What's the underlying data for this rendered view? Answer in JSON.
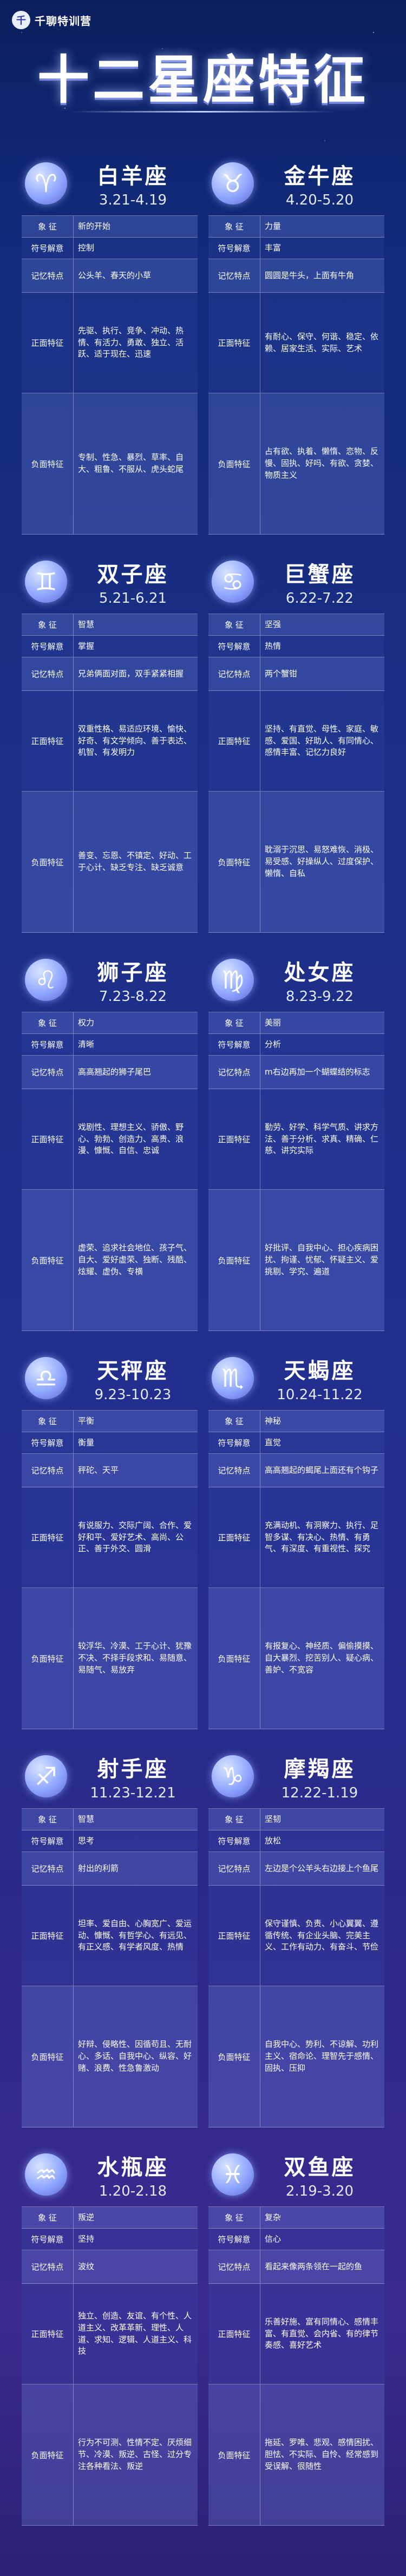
{
  "brand": {
    "name": "千聊特训营",
    "logo_glyph": "千"
  },
  "title": "十二星座特征",
  "row_labels": {
    "symbol": "象    征",
    "symbol_id": "符号解意",
    "mnemonic": "记忆特点",
    "positive": "正面特征",
    "negative": "负面特征"
  },
  "signs": [
    {
      "name": "白羊座",
      "dates": "3.21-4.19",
      "icon": "aries-icon",
      "glyph": "♈",
      "symbol": "新的开始",
      "symbol_id": "控制",
      "mnemonic": "公头羊、春天的小草",
      "positive": "先驱、执行、竞争、冲动、热情、有活力、勇敢、独立、活跃、适于现在、迅速",
      "negative": "专制、性急、暴烈、草率、自大、粗鲁、不服从、虎头蛇尾"
    },
    {
      "name": "金牛座",
      "dates": "4.20-5.20",
      "icon": "taurus-icon",
      "glyph": "♉",
      "symbol": "力量",
      "symbol_id": "丰富",
      "mnemonic": "圆圆是牛头，上面有牛角",
      "positive": "有耐心、保守、何谐、稳定、依赖、居家生活、实际、艺术",
      "negative": "占有欲、执着、懒惰、恋物、反慢、固执、好吗、有欲、贪婪、物质主义"
    },
    {
      "name": "双子座",
      "dates": "5.21-6.21",
      "icon": "gemini-icon",
      "glyph": "♊",
      "symbol": "智慧",
      "symbol_id": "掌握",
      "mnemonic": "兄弟俩面对面，双手紧紧相握",
      "positive": "双重性格、易适应环境、愉快、好奇、有文学倾向、善于表达、机智、有发明力",
      "negative": "善变、忘恩、不镇定、好动、工于心计、缺乏专注、缺乏诚意"
    },
    {
      "name": "巨蟹座",
      "dates": "6.22-7.22",
      "icon": "cancer-icon",
      "glyph": "♋",
      "symbol": "坚强",
      "symbol_id": "热情",
      "mnemonic": "两个蟹钳",
      "positive": "坚持、有直觉、母性、家庭、敏感、爱国、好助人、有同情心、感情丰富、记忆力良好",
      "negative": "耽溺于沉思、易怒难恢、消极、易受感、好操纵人、过度保护、懒惰、自私"
    },
    {
      "name": "狮子座",
      "dates": "7.23-8.22",
      "icon": "leo-icon",
      "glyph": "♌",
      "symbol": "权力",
      "symbol_id": "清晰",
      "mnemonic": "高高翘起的狮子尾巴",
      "positive": "戏剧性、理想主义、骄傲、野心、勃勃、创造力、高贵、浪漫、慷慨、自信、忠诚",
      "negative": "虚荣、追求社会地位、孩子气、自大、爱好虚荣、独断、残酷、炫耀、虚伪、专横"
    },
    {
      "name": "处女座",
      "dates": "8.23-9.22",
      "icon": "virgo-icon",
      "glyph": "♍",
      "symbol": "美丽",
      "symbol_id": "分析",
      "mnemonic": "m右边再加一个蝴蝶结的标志",
      "positive": "勤劳、好学、科学气质、讲求方法、善于分析、求真、精确、仁慈、讲究实际",
      "negative": "好批评、自我中心、担心疾病困扰、拘谨、忧郁、怀疑主义、爱挑剔、学究、遍道"
    },
    {
      "name": "天秤座",
      "dates": "9.23-10.23",
      "icon": "libra-icon",
      "glyph": "♎",
      "symbol": "平衡",
      "symbol_id": "衡量",
      "mnemonic": "秤砣、天平",
      "positive": "有说服力、交际广阔、合作、爱好和平、爱好艺术、高尚、公正、善于外交、圆滑",
      "negative": "较浮华、冷漠、工于心计、犹豫不决、不择手段求和、易随意、易随气、易放弃"
    },
    {
      "name": "天蝎座",
      "dates": "10.24-11.22",
      "icon": "scorpio-icon",
      "glyph": "♏",
      "symbol": "神秘",
      "symbol_id": "直觉",
      "mnemonic": "高高翘起的蝎尾上面还有个钩子",
      "positive": "充满动机、有洞察力、执行、足智多谋、有决心、热情、有勇气、有深度、有重视性、探究",
      "negative": "有报复心、神经质、偏偷摸摸、自大暴烈、挖苦别人、疑心病、善妒、不宽容"
    },
    {
      "name": "射手座",
      "dates": "11.23-12.21",
      "icon": "sagittarius-icon",
      "glyph": "♐",
      "symbol": "智慧",
      "symbol_id": "思考",
      "mnemonic": "射出的利箭",
      "positive": "坦率、爱自由、心胸宽广、爱运动、慷慨、有哲学心、有远见、有正义感、有学者风度、热情",
      "negative": "好辩、侵略性、因循苟且、无耐心、多话、自我中心、纵容、好赌、浪费、性急鲁激动"
    },
    {
      "name": "摩羯座",
      "dates": "12.22-1.19",
      "icon": "capricorn-icon",
      "glyph": "♑",
      "symbol": "坚韧",
      "symbol_id": "放松",
      "mnemonic": "左边是个公羊头右边接上个鱼尾",
      "positive": "保守谨慎、负责、小心翼翼、遵循传统、有企业头脑、完美主义、工作有动力、有奋斗、节俭",
      "negative": "自我中心、势利、不谅解、功利主义、宿命论、理智先于感情、固执、压抑"
    },
    {
      "name": "水瓶座",
      "dates": "1.20-2.18",
      "icon": "aquarius-icon",
      "glyph": "♒",
      "symbol": "叛逆",
      "symbol_id": "坚持",
      "mnemonic": "波纹",
      "positive": "独立、创造、友谊、有个性、人道主义、改革革新、理性、人道、求知、逻辑、人道主义、科技",
      "negative": "行为不可测、性情不定、厌烦细节、冷漠、叛逆、古怪、过分专注各种看法、叛逆"
    },
    {
      "name": "双鱼座",
      "dates": "2.19-3.20",
      "icon": "pisces-icon",
      "glyph": "♓",
      "symbol": "复杂",
      "symbol_id": "信心",
      "mnemonic": "看起来像两条领在一起的鱼",
      "positive": "乐善好施、富有同情心、感情丰富、有直觉、会内省、有的律节奏感、喜好艺术",
      "negative": "拖延、罗唯、悲观、感情困扰、胆怯、不实际、自怜、经常感到受误解、很随性"
    }
  ]
}
